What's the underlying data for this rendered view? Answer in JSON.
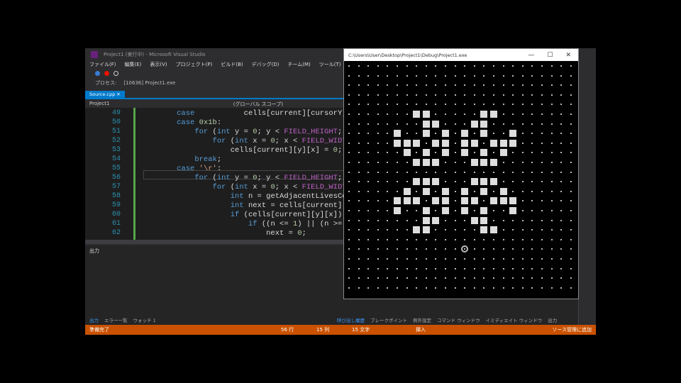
{
  "window": {
    "title": "Project1 (実行中) - Microsoft Visual Studio"
  },
  "menu": [
    "ファイル(F)",
    "編集(E)",
    "表示(V)",
    "プロジェクト(P)",
    "ビルド(B)",
    "デバッグ(D)",
    "チーム(M)",
    "ツール(T)",
    "テスト(S)",
    "分析(N)"
  ],
  "toolbar2": {
    "process_label": "プロセス:",
    "process_value": "[10636] Project1.exe"
  },
  "tabs": [
    {
      "label": "Source.cpp"
    }
  ],
  "navbar": {
    "project": "Project1",
    "scope": "(グローバル スコープ)"
  },
  "colors": {
    "accent": "#007acc",
    "status": "#ca5100",
    "change_bar": "#57a64a"
  },
  "code": [
    {
      "n": "49",
      "t": [
        [
          "       "
        ],
        [
          "case",
          "kw"
        ],
        [
          "           cells[current][cursorY][cursorX] = !cells"
        ]
      ]
    },
    {
      "n": "50",
      "t": [
        [
          "       "
        ],
        [
          "case",
          "kw"
        ],
        [
          " "
        ],
        [
          "0x1b",
          "num"
        ],
        [
          ":"
        ]
      ]
    },
    {
      "n": "51",
      "t": [
        [
          "           "
        ],
        [
          "for",
          "kw"
        ],
        [
          " ("
        ],
        [
          "int",
          "kw"
        ],
        [
          " y = "
        ],
        [
          "0",
          "num"
        ],
        [
          "; y < "
        ],
        [
          "FIELD_HEIGHT",
          "mac"
        ],
        [
          "; y++)"
        ]
      ]
    },
    {
      "n": "52",
      "t": [
        [
          "               "
        ],
        [
          "for",
          "kw"
        ],
        [
          " ("
        ],
        [
          "int",
          "kw"
        ],
        [
          " x = "
        ],
        [
          "0",
          "num"
        ],
        [
          "; x < "
        ],
        [
          "FIELD_WIDTH",
          "mac"
        ],
        [
          "; x++)"
        ]
      ]
    },
    {
      "n": "53",
      "t": [
        [
          "                   cells[current][y][x] = "
        ],
        [
          "0",
          "num"
        ],
        [
          ";"
        ]
      ]
    },
    {
      "n": "54",
      "t": [
        [
          "           "
        ],
        [
          "break",
          "kw"
        ],
        [
          ";"
        ]
      ]
    },
    {
      "n": "55",
      "t": [
        [
          "       "
        ],
        [
          "case",
          "kw"
        ],
        [
          " "
        ],
        [
          "'\\r'",
          "chr"
        ],
        [
          ":"
        ]
      ]
    },
    {
      "n": "56",
      "t": [
        [
          "           "
        ],
        [
          "for",
          "kw"
        ],
        [
          " ("
        ],
        [
          "int",
          "kw"
        ],
        [
          " y = "
        ],
        [
          "0",
          "num"
        ],
        [
          "; y < "
        ],
        [
          "FIELD_HEIGHT",
          "mac"
        ],
        [
          "; y++)"
        ]
      ]
    },
    {
      "n": "57",
      "t": [
        [
          "               "
        ],
        [
          "for",
          "kw"
        ],
        [
          " ("
        ],
        [
          "int",
          "kw"
        ],
        [
          " x = "
        ],
        [
          "0",
          "num"
        ],
        [
          "; x < "
        ],
        [
          "FIELD_WIDTH",
          "mac"
        ],
        [
          "; x++) {"
        ]
      ]
    },
    {
      "n": "58",
      "t": [
        [
          "                   "
        ],
        [
          "int",
          "kw"
        ],
        [
          " n = getAdjacentLivesCount(x, y);"
        ]
      ]
    },
    {
      "n": "59",
      "t": [
        [
          "                   "
        ],
        [
          "int",
          "kw"
        ],
        [
          " next = cells[current][y][x];"
        ]
      ]
    },
    {
      "n": "60",
      "t": [
        [
          "                   "
        ],
        [
          "if",
          "kw"
        ],
        [
          " (cells[current][y][x]) {"
        ]
      ]
    },
    {
      "n": "61",
      "t": [
        [
          "                       "
        ],
        [
          "if",
          "kw"
        ],
        [
          " ((n <= "
        ],
        [
          "1",
          "num"
        ],
        [
          ") || (n >= "
        ],
        [
          "4",
          "num"
        ],
        [
          "))"
        ]
      ]
    },
    {
      "n": "62",
      "t": [
        [
          "                           next = "
        ],
        [
          "0",
          "num"
        ],
        [
          ";"
        ]
      ]
    }
  ],
  "output_panel": {
    "title": "出力",
    "bottom_tabs": [
      "出力",
      "エラー一覧",
      "ウォッチ 1"
    ]
  },
  "right_panel": {
    "bottom_tabs": [
      "呼び出し履歴",
      "ブレークポイント",
      "例外設定",
      "コマンド ウィンドウ",
      "イミディエイト ウィンドウ",
      "出力"
    ]
  },
  "status": {
    "ready": "準備完了",
    "line": "56 行",
    "col": "15 列",
    "ch": "15 文字",
    "mode": "挿入",
    "source_control": "ソース管理に追加"
  },
  "console": {
    "title": "C:\\Users\\User\\Desktop\\Project1\\Debug\\Project1.exe",
    "minimize": "—",
    "maximize": "☐",
    "close": "✕",
    "field": [
      "........................",
      "........................",
      "........................",
      "........................",
      "........................",
      ".......##.....##........",
      "........##...##.........",
      ".....#..#.#.#.#..#......",
      ".....###.##.##.###......",
      "......#.#.#.#.#.#.......",
      ".......###...###........",
      "........................",
      ".......###...###........",
      "......#.#.#.#.#.#.......",
      ".....###.##.##.###......",
      ".....#..#.#.#.#..#......",
      "........##...##.........",
      ".......##.....##........",
      "........................",
      "........................",
      "........................",
      "........................",
      "........................",
      "........................"
    ],
    "cursor": {
      "x": 12,
      "y": 19
    }
  }
}
